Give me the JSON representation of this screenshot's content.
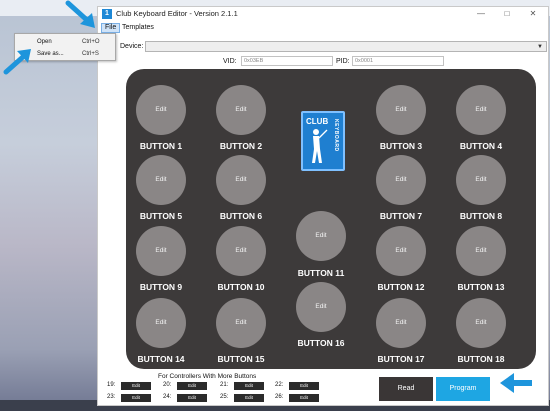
{
  "window": {
    "title": "Club Keyboard Editor - Version 2.1.1",
    "icon_text": "1"
  },
  "window_controls": {
    "minimize": "—",
    "maximize": "□",
    "close": "✕"
  },
  "menu": {
    "file": "File",
    "templates": "Templates"
  },
  "file_menu": [
    {
      "label": "Open",
      "shortcut": "Ctrl+O"
    },
    {
      "label": "Save as...",
      "shortcut": "Ctrl+S"
    }
  ],
  "device": {
    "label": "Device:",
    "value": ""
  },
  "vid": {
    "label": "VID:",
    "value": "0x03EB"
  },
  "pid": {
    "label": "PID:",
    "value": "0x0001"
  },
  "edit_label": "Edit",
  "buttons": [
    "BUTTON 1",
    "BUTTON 2",
    "BUTTON 3",
    "BUTTON 4",
    "BUTTON 5",
    "BUTTON 6",
    "BUTTON 7",
    "BUTTON 8",
    "BUTTON 9",
    "BUTTON 10",
    "BUTTON 11",
    "BUTTON 12",
    "BUTTON 13",
    "BUTTON 14",
    "BUTTON 15",
    "BUTTON 16",
    "BUTTON 17",
    "BUTTON 18"
  ],
  "logo": {
    "club": "CLUB",
    "keyboard": "KEYBOARD"
  },
  "more_buttons": {
    "title": "For Controllers With More Buttons",
    "items": [
      {
        "num": "19:",
        "label": "Edit"
      },
      {
        "num": "20:",
        "label": "Edit"
      },
      {
        "num": "21:",
        "label": "Edit"
      },
      {
        "num": "22:",
        "label": "Edit"
      },
      {
        "num": "23:",
        "label": "Edit"
      },
      {
        "num": "24:",
        "label": "Edit"
      },
      {
        "num": "25:",
        "label": "Edit"
      },
      {
        "num": "26:",
        "label": "Edit"
      }
    ]
  },
  "actions": {
    "read": "Read",
    "program": "Program"
  },
  "colors": {
    "accent": "#1ea6e3",
    "board": "#3d3a3a",
    "arrow": "#1e95dc"
  }
}
